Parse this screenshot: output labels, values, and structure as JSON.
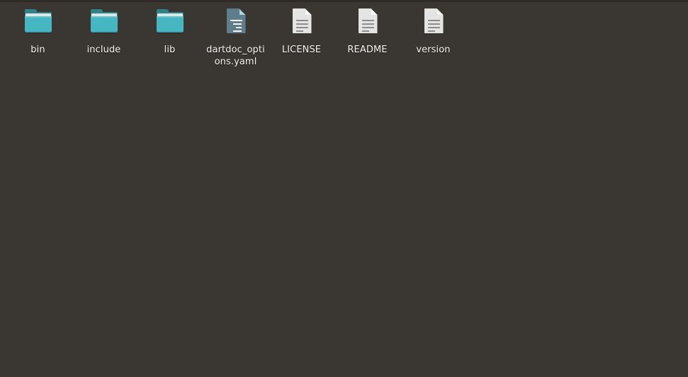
{
  "desktop": {
    "background_color": "#3a3631",
    "top_strip_color": "#2e2b27",
    "folder_color": "#45b6c2",
    "folder_tab_color": "#2e8289",
    "document_color": "#e4e4e2",
    "yaml_document_color": "#607d8b",
    "label_color": "#f3f3f1"
  },
  "icons": [
    {
      "name": "bin",
      "label": "bin",
      "type": "folder",
      "icon": "folder-icon"
    },
    {
      "name": "include",
      "label": "include",
      "type": "folder",
      "icon": "folder-icon"
    },
    {
      "name": "lib",
      "label": "lib",
      "type": "folder",
      "icon": "folder-icon"
    },
    {
      "name": "dartdoc_options.yaml",
      "label": "dartdoc_options.yaml",
      "type": "yaml",
      "icon": "yaml-file-icon"
    },
    {
      "name": "LICENSE",
      "label": "LICENSE",
      "type": "document",
      "icon": "text-file-icon"
    },
    {
      "name": "README",
      "label": "README",
      "type": "document",
      "icon": "text-file-icon"
    },
    {
      "name": "version",
      "label": "version",
      "type": "document",
      "icon": "text-file-icon"
    }
  ]
}
